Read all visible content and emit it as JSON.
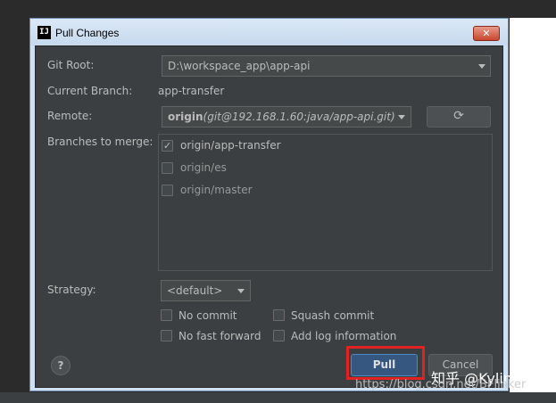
{
  "dialog": {
    "title": "Pull Changes",
    "app_icon": "IJ",
    "close_glyph": "✕"
  },
  "form": {
    "git_root_label": "Git Root:",
    "git_root_value": "D:\\workspace_app\\app-api",
    "current_branch_label": "Current Branch:",
    "current_branch_value": "app-transfer",
    "remote_label": "Remote:",
    "remote_name": "origin",
    "remote_url": "(git@192.168.1.60:java/app-api.git)",
    "refresh_icon": "⟳",
    "branches_label": "Branches to merge:",
    "branches": [
      {
        "name": "origin/app-transfer",
        "checked": true
      },
      {
        "name": "origin/es",
        "checked": false
      },
      {
        "name": "origin/master",
        "checked": false
      }
    ],
    "strategy_label": "Strategy:",
    "strategy_value": "<default>",
    "options": {
      "no_commit": "No commit",
      "squash_commit": "Squash commit",
      "no_fast_forward": "No fast forward",
      "add_log_information": "Add log information"
    }
  },
  "buttons": {
    "help": "?",
    "pull": "Pull",
    "cancel": "Cancel"
  },
  "watermark": {
    "zhihu": "知乎 @Kylin何",
    "url": "https://blog.csdn.net/BFlinker"
  },
  "colors": {
    "highlight": "#e02222",
    "primary_button": "#365880",
    "panel": "#3c3f41"
  }
}
